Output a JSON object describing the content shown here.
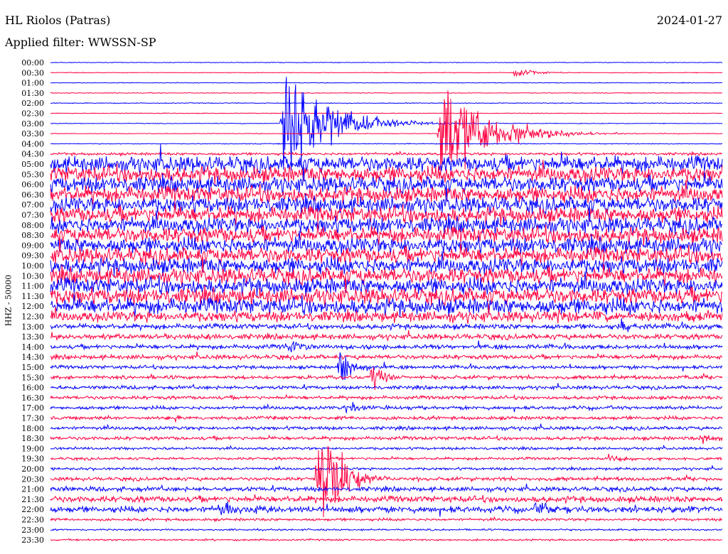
{
  "header": {
    "station": "HL Riolos (Patras)",
    "date": "2024-01-27",
    "filter": "Applied filter: WWSSN-SP"
  },
  "chart_data": {
    "type": "line",
    "title": "HL Riolos (Patras)",
    "ylabel": "HHZ - 50000",
    "row_labels": [
      "00:00",
      "00:30",
      "01:00",
      "01:30",
      "02:00",
      "02:30",
      "03:00",
      "03:30",
      "04:00",
      "04:30",
      "05:00",
      "05:30",
      "06:00",
      "06:30",
      "07:00",
      "07:30",
      "08:00",
      "08:30",
      "09:00",
      "09:30",
      "10:00",
      "10:30",
      "11:00",
      "11:30",
      "12:00",
      "12:30",
      "13:00",
      "13:30",
      "14:00",
      "14:30",
      "15:00",
      "15:30",
      "16:00",
      "16:30",
      "17:00",
      "17:30",
      "18:00",
      "18:30",
      "19:00",
      "19:30",
      "20:00",
      "20:30",
      "21:00",
      "21:30",
      "22:00",
      "22:30",
      "23:00",
      "23:30"
    ],
    "colors": {
      "even": "#0000ff",
      "odd": "#ff0040"
    },
    "noise_level": [
      0.4,
      0.4,
      0.4,
      0.4,
      0.5,
      0.4,
      0.4,
      0.4,
      0.5,
      1.5,
      9,
      9,
      9,
      9,
      9,
      9,
      9,
      9,
      9,
      9,
      9,
      9,
      9,
      9,
      9,
      6,
      3,
      3,
      2.5,
      2.5,
      2,
      2,
      2,
      2,
      2,
      2,
      2,
      2,
      1.5,
      1.5,
      1.5,
      2,
      2.5,
      3.5,
      3.5,
      1.5,
      1,
      1
    ],
    "events": [
      {
        "row": 6,
        "x": 0.345,
        "amp": 85,
        "decay": 0.06
      },
      {
        "row": 7,
        "x": 0.58,
        "amp": 80,
        "decay": 0.06
      },
      {
        "row": 1,
        "x": 0.69,
        "amp": 6,
        "decay": 0.03
      },
      {
        "row": 41,
        "x": 0.398,
        "amp": 95,
        "decay": 0.03
      },
      {
        "row": 30,
        "x": 0.43,
        "amp": 30,
        "decay": 0.02
      },
      {
        "row": 39,
        "x": 0.83,
        "amp": 8,
        "decay": 0.03
      },
      {
        "row": 31,
        "x": 0.48,
        "amp": 25,
        "decay": 0.015
      },
      {
        "row": 44,
        "x": 0.25,
        "amp": 8,
        "decay": 0.06
      },
      {
        "row": 44,
        "x": 0.72,
        "amp": 8,
        "decay": 0.05
      },
      {
        "row": 34,
        "x": 0.44,
        "amp": 8,
        "decay": 0.04
      },
      {
        "row": 37,
        "x": 0.97,
        "amp": 10,
        "decay": 0.02
      },
      {
        "row": 28,
        "x": 0.35,
        "amp": 10,
        "decay": 0.03
      },
      {
        "row": 26,
        "x": 0.85,
        "amp": 8,
        "decay": 0.02
      },
      {
        "row": 25,
        "x": 0.75,
        "amp": 10,
        "decay": 0.02
      }
    ]
  }
}
